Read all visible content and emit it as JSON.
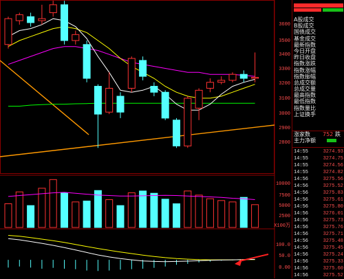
{
  "price_axis": [
    "3600",
    "3500",
    "3400",
    "3300",
    "3200",
    "3100",
    "3000",
    "2900",
    "2800"
  ],
  "volume_axis": [
    "10000",
    "7500",
    "5000",
    "2500"
  ],
  "volume_unit": "X100万",
  "indicator_axis": [
    "100.0",
    "50.0",
    "0.00"
  ],
  "menu": [
    "A股成交",
    "B股成交",
    "国债成交",
    "基金成交",
    "最新指数",
    "今日开盘",
    "昨日收盘",
    "指数涨跌",
    "指数涨幅",
    "指数振幅",
    "总成交额",
    "总成交量",
    "最高指数",
    "最低指数",
    "指数量比",
    "上证换手",
    "涨家数",
    "主力净额"
  ],
  "rise_count": "752",
  "rise_suffix": "跌",
  "ticks": [
    {
      "time": "14:55",
      "price": "3274.93"
    },
    {
      "time": "14:55",
      "price": "3274.75"
    },
    {
      "time": "14:55",
      "price": "3274.56"
    },
    {
      "time": "14:55",
      "price": "3274.82"
    },
    {
      "time": "14:56",
      "price": "3275.56"
    },
    {
      "time": "14:56",
      "price": "3275.52"
    },
    {
      "time": "14:56",
      "price": "3275.83"
    },
    {
      "time": "14:56",
      "price": "3275.61"
    },
    {
      "time": "14:56",
      "price": "3275.80"
    },
    {
      "time": "14:56",
      "price": "3276.01"
    },
    {
      "time": "14:56",
      "price": "3275.73"
    },
    {
      "time": "14:56",
      "price": "3275.76"
    },
    {
      "time": "14:56",
      "price": "3275.71"
    },
    {
      "time": "14:56",
      "price": "3275.48"
    },
    {
      "time": "14:56",
      "price": "3275.45"
    },
    {
      "time": "14:56",
      "price": "3275.24"
    },
    {
      "time": "14:56",
      "price": "3275.33"
    },
    {
      "time": "14:56",
      "price": "3275.60"
    },
    {
      "time": "14:56",
      "price": "3275.52"
    }
  ],
  "colors": {
    "up": "#ff3232",
    "down": "#54ffff",
    "ma5": "#ffffff",
    "ma10": "#ffff00",
    "ma20": "#ff00ff",
    "ma60": "#00ff00",
    "trend": "#ff9900",
    "arrow": "#ff2020"
  },
  "chart_data": {
    "type": "candlestick",
    "ylim": [
      2800,
      3650
    ],
    "candles": [
      {
        "o": 3440,
        "c": 3570,
        "h": 3580,
        "l": 3420
      },
      {
        "o": 3560,
        "c": 3590,
        "h": 3600,
        "l": 3540
      },
      {
        "o": 3580,
        "c": 3550,
        "h": 3600,
        "l": 3530
      },
      {
        "o": 3560,
        "c": 3570,
        "h": 3640,
        "l": 3540
      },
      {
        "o": 3600,
        "c": 3640,
        "h": 3660,
        "l": 3580
      },
      {
        "o": 3640,
        "c": 3460,
        "h": 3660,
        "l": 3440
      },
      {
        "o": 3460,
        "c": 3490,
        "h": 3510,
        "l": 3440
      },
      {
        "o": 3440,
        "c": 3270,
        "h": 3460,
        "l": 3250
      },
      {
        "o": 3230,
        "c": 3090,
        "h": 3240,
        "l": 2920
      },
      {
        "o": 3100,
        "c": 3220,
        "h": 3300,
        "l": 3090
      },
      {
        "o": 3180,
        "c": 3100,
        "h": 3200,
        "l": 3070
      },
      {
        "o": 3220,
        "c": 3370,
        "h": 3380,
        "l": 3200
      },
      {
        "o": 3360,
        "c": 3280,
        "h": 3380,
        "l": 3260
      },
      {
        "o": 3230,
        "c": 3200,
        "h": 3250,
        "l": 3180
      },
      {
        "o": 3200,
        "c": 3070,
        "h": 3210,
        "l": 3060
      },
      {
        "o": 3060,
        "c": 2930,
        "h": 3070,
        "l": 2920
      },
      {
        "o": 2930,
        "c": 3170,
        "h": 3180,
        "l": 2920
      },
      {
        "o": 3120,
        "c": 3210,
        "h": 3220,
        "l": 3060
      },
      {
        "o": 3220,
        "c": 3250,
        "h": 3270,
        "l": 3200
      },
      {
        "o": 3250,
        "c": 3260,
        "h": 3280,
        "l": 3240
      },
      {
        "o": 3260,
        "c": 3290,
        "h": 3300,
        "l": 3250
      },
      {
        "o": 3290,
        "c": 3270,
        "h": 3310,
        "l": 3250
      },
      {
        "o": 3270,
        "c": 3275,
        "h": 3400,
        "l": 3250
      }
    ],
    "ma5": [
      3480,
      3510,
      3520,
      3540,
      3570,
      3560,
      3530,
      3470,
      3380,
      3300,
      3210,
      3200,
      3210,
      3230,
      3190,
      3140,
      3110,
      3110,
      3140,
      3190,
      3230,
      3250,
      3265
    ],
    "ma10": [
      3430,
      3460,
      3480,
      3500,
      3520,
      3530,
      3520,
      3500,
      3460,
      3420,
      3370,
      3330,
      3300,
      3270,
      3230,
      3200,
      3180,
      3170,
      3170,
      3180,
      3200,
      3220,
      3240
    ],
    "ma20": [
      3340,
      3360,
      3380,
      3400,
      3420,
      3430,
      3430,
      3420,
      3410,
      3390,
      3370,
      3350,
      3340,
      3330,
      3320,
      3310,
      3300,
      3300,
      3290,
      3290,
      3290,
      3285,
      3280
    ],
    "ma60": [
      3130,
      3130,
      3135,
      3138,
      3140,
      3140,
      3142,
      3143,
      3145,
      3145,
      3145,
      3145,
      3145,
      3145,
      3145,
      3145,
      3145,
      3145,
      3145,
      3145,
      3145,
      3145,
      3145
    ],
    "volume_ylim": [
      0,
      11000
    ],
    "volume": [
      5200,
      7800,
      4800,
      8600,
      10500,
      7600,
      5600,
      5800,
      8100,
      6100,
      4800,
      7600,
      8000,
      7500,
      6200,
      5200,
      8000,
      7100,
      6300,
      5900,
      5600,
      6600,
      5000
    ],
    "volume_ma": [
      6800,
      7000,
      7200,
      7400,
      7600,
      7700,
      7500,
      7300,
      7100,
      7000,
      6900,
      6900,
      6950,
      7000,
      7050,
      7000,
      6900,
      6800,
      6700,
      6600,
      6400,
      6300,
      6100
    ],
    "indicator_ylim": [
      -80,
      130
    ],
    "dif": [
      95,
      90,
      82,
      74,
      65,
      55,
      44,
      33,
      22,
      13,
      6,
      0,
      -5,
      -7,
      -8,
      -7,
      -6,
      -4,
      -2,
      -1,
      0,
      1,
      2
    ],
    "dea": [
      110,
      106,
      100,
      93,
      86,
      78,
      69,
      60,
      51,
      43,
      35,
      28,
      21,
      15,
      10,
      6,
      3,
      1,
      0,
      0,
      0,
      1,
      1
    ],
    "macd": [
      -35,
      -30,
      -35,
      -40,
      -36,
      -40,
      -42,
      -48,
      -50,
      -48,
      -44,
      -42,
      -40,
      -36,
      -30,
      -22,
      -18,
      -12,
      -8,
      -4,
      -2,
      -1,
      0
    ]
  }
}
